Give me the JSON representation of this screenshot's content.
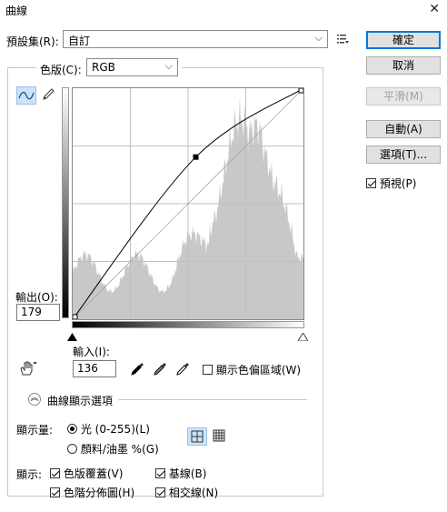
{
  "window": {
    "title": "曲線"
  },
  "preset": {
    "label": "預設集(R):",
    "value": "自訂"
  },
  "buttons": {
    "ok": "確定",
    "cancel": "取消",
    "smooth": "平滑(M)",
    "auto": "自動(A)",
    "options": "選項(T)..."
  },
  "preview": {
    "label": "預視(P)",
    "checked": true
  },
  "channel": {
    "label": "色版(C):",
    "value": "RGB"
  },
  "output": {
    "label": "輸出(O):",
    "value": "179"
  },
  "input": {
    "label": "輸入(I):",
    "value": "136"
  },
  "show_clipping": {
    "label": "顯示色偏區域(W)",
    "checked": false
  },
  "display_options": {
    "label": "曲線顯示選項",
    "amount_label": "顯示量:",
    "light_option": "光 (0-255)(L)",
    "pigment_option": "顏料/油墨 %(G)",
    "show_label": "顯示:",
    "channel_overlays": "色版覆蓋(V)",
    "baseline": "基線(B)",
    "histogram": "色階分佈圖(H)",
    "intersection_line": "相交線(N)"
  },
  "curve": {
    "points": [
      [
        0,
        0
      ],
      [
        136,
        179
      ],
      [
        255,
        255
      ]
    ]
  },
  "colors": {
    "accent": "#0078d7",
    "histogram": "#c8c8c8",
    "toggle_active": "#cde3f7"
  },
  "icons": [
    "close-icon",
    "preset-menu-icon",
    "curve-point-tool-icon",
    "pencil-tool-icon",
    "targeted-adjustment-icon",
    "black-eyedropper-icon",
    "gray-eyedropper-icon",
    "white-eyedropper-icon",
    "collapse-chevron-icon",
    "simple-grid-icon",
    "detailed-grid-icon"
  ]
}
